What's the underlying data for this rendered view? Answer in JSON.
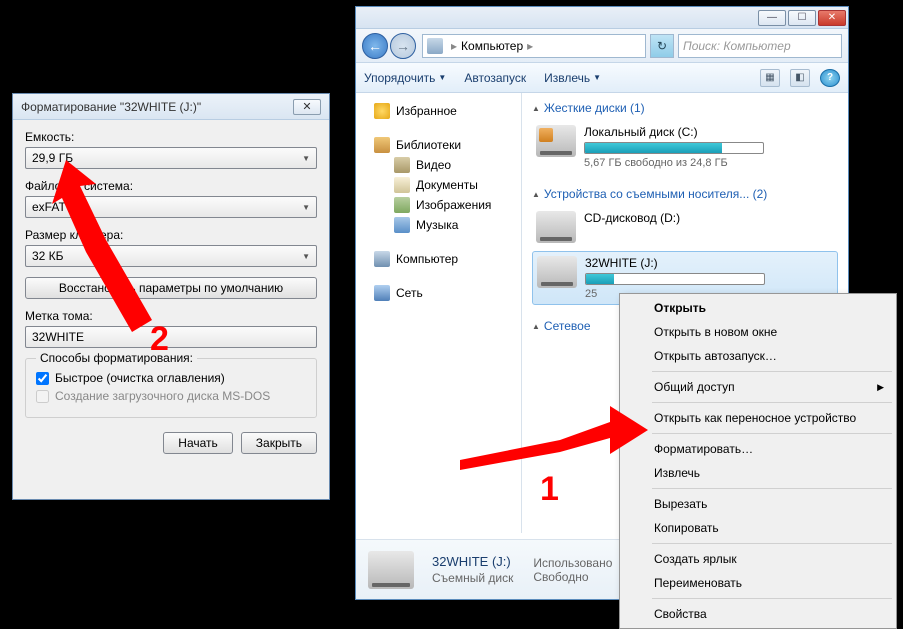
{
  "explorer": {
    "breadcrumb": "Компьютер",
    "search_placeholder": "Поиск: Компьютер",
    "toolbar": {
      "organize": "Упорядочить",
      "autoplay": "Автозапуск",
      "eject": "Извлечь"
    },
    "sidebar": {
      "favorites": "Избранное",
      "libraries": "Библиотеки",
      "video": "Видео",
      "documents": "Документы",
      "images": "Изображения",
      "music": "Музыка",
      "computer": "Компьютер",
      "network": "Сеть"
    },
    "groups": {
      "hdd": "Жесткие диски (1)",
      "removable": "Устройства со съемными носителя... (2)",
      "netloc": "Сетевое"
    },
    "drives": {
      "c": {
        "name": "Локальный диск (C:)",
        "stat": "5,67 ГБ свободно из 24,8 ГБ",
        "fill": 77
      },
      "d": {
        "name": "CD-дисковод (D:)"
      },
      "j": {
        "name": "32WHITE (J:)",
        "stat": "25",
        "fill": 16
      }
    },
    "status": {
      "name": "32WHITE (J:)",
      "type": "Съемный диск",
      "used_label": "Использовано",
      "free_label": "Свободно"
    }
  },
  "context_menu": {
    "open": "Открыть",
    "open_new": "Открыть в новом окне",
    "open_autoplay": "Открыть автозапуск…",
    "share": "Общий доступ",
    "open_portable": "Открыть как переносное устройство",
    "format": "Форматировать…",
    "eject": "Извлечь",
    "cut": "Вырезать",
    "copy": "Копировать",
    "shortcut": "Создать ярлык",
    "rename": "Переименовать",
    "properties": "Свойства"
  },
  "dialog": {
    "title": "Форматирование \"32WHITE (J:)\"",
    "capacity_label": "Емкость:",
    "capacity_value": "29,9 ГБ",
    "fs_label": "Файловая система:",
    "fs_value": "exFAT",
    "cluster_label": "Размер кластера:",
    "cluster_value": "32 КБ",
    "restore_defaults": "Восстановить параметры по умолчанию",
    "volume_label": "Метка тома:",
    "volume_value": "32WHITE",
    "methods_label": "Способы форматирования:",
    "quick": "Быстрое (очистка оглавления)",
    "bootdisk": "Создание загрузочного диска MS-DOS",
    "start": "Начать",
    "close": "Закрыть"
  },
  "annotations": {
    "one": "1",
    "two": "2"
  }
}
